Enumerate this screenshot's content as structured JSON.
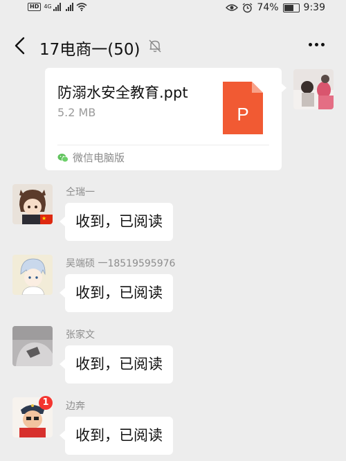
{
  "status_bar": {
    "network": "4G",
    "battery": "74%",
    "battery_level": 0.74,
    "time": "9:39"
  },
  "nav": {
    "title": "17电商一(50)"
  },
  "file_message": {
    "file_name": "防溺水安全教育.ppt",
    "file_size": "5.2 MB",
    "file_type_letter": "P",
    "source": "微信电脑版",
    "icon_color": "#f15a33"
  },
  "messages": [
    {
      "sender": "仝瑞一",
      "text": "收到，已阅读"
    },
    {
      "sender": "吴端硕 一18519595976",
      "text": "收到，已阅读"
    },
    {
      "sender": "张家文",
      "text": "收到，已阅读"
    },
    {
      "sender": "边奔",
      "text": "收到，已阅读",
      "badge": "1"
    }
  ]
}
